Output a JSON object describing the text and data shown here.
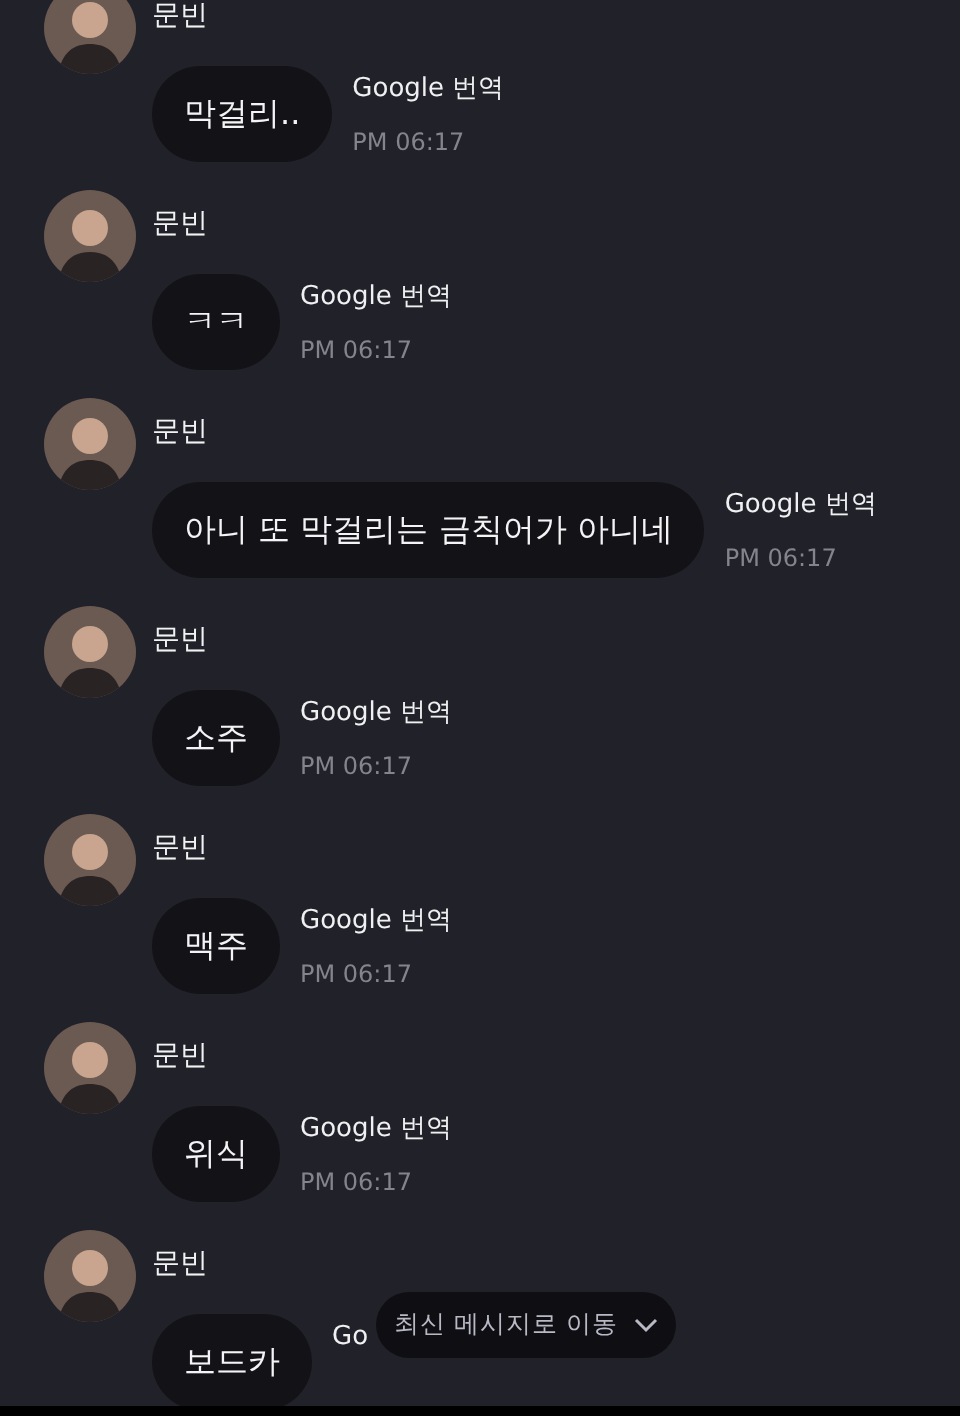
{
  "messages": [
    {
      "sender": "문빈",
      "text": "막걸리..",
      "translate_label": "Google 번역",
      "time": "PM 06:17"
    },
    {
      "sender": "문빈",
      "text": "ㅋㅋ",
      "translate_label": "Google 번역",
      "time": "PM 06:17"
    },
    {
      "sender": "문빈",
      "text": "아니 또 막걸리는 금칙어가 아니네",
      "translate_label": "Google 번역",
      "time": "PM 06:17"
    },
    {
      "sender": "문빈",
      "text": "소주",
      "translate_label": "Google 번역",
      "time": "PM 06:17"
    },
    {
      "sender": "문빈",
      "text": "맥주",
      "translate_label": "Google 번역",
      "time": "PM 06:17"
    },
    {
      "sender": "문빈",
      "text": "위식",
      "translate_label": "Google 번역",
      "time": "PM 06:17"
    },
    {
      "sender": "문빈",
      "text": "보드카",
      "translate_label": "Go"
    }
  ],
  "jump_button": {
    "label": "최신 메시지로 이동"
  }
}
